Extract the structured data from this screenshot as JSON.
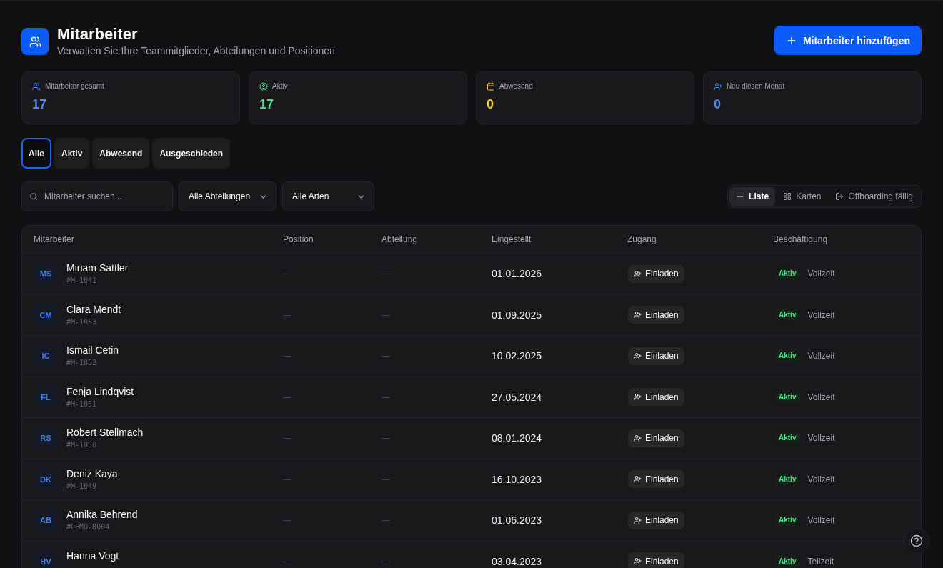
{
  "header": {
    "title": "Mitarbeiter",
    "subtitle": "Verwalten Sie Ihre Teammitglieder, Abteilungen und Positionen",
    "add_button": "Mitarbeiter hinzufügen"
  },
  "stats": [
    {
      "label": "Mitarbeiter gesamt",
      "value": "17",
      "color": "#4f86f7"
    },
    {
      "label": "Aktiv",
      "value": "17",
      "color": "#4ade80"
    },
    {
      "label": "Abwesend",
      "value": "0",
      "color": "#facc15"
    },
    {
      "label": "Neu diesen Monat",
      "value": "0",
      "color": "#4f86f7"
    }
  ],
  "tabs": [
    {
      "label": "Alle",
      "selected": true
    },
    {
      "label": "Aktiv",
      "selected": false
    },
    {
      "label": "Abwesend",
      "selected": false
    },
    {
      "label": "Ausgeschieden",
      "selected": false
    }
  ],
  "filters": {
    "search": {
      "placeholder": "Mitarbeiter suchen..."
    },
    "selects": [
      {
        "value": "Alle Abteilungen"
      },
      {
        "value": "Alle Arten"
      }
    ]
  },
  "view_modes": [
    {
      "label": "Liste",
      "selected": true
    },
    {
      "label": "Karten",
      "selected": false
    },
    {
      "label": "Offboarding fällig",
      "selected": false
    }
  ],
  "table": {
    "columns": [
      "Mitarbeiter",
      "Position",
      "Abteilung",
      "Eingestellt",
      "Zugang",
      "Beschäftigung"
    ],
    "rows": [
      {
        "initials": "MS",
        "name": "Miriam Sattler",
        "id": "#M-1041",
        "position": "—",
        "department": "—",
        "hired": "01.01.2026",
        "access": "Einladen",
        "status": "Aktiv",
        "employment": "Vollzeit"
      },
      {
        "initials": "CM",
        "name": "Clara Mendt",
        "id": "#M-1053",
        "position": "—",
        "department": "—",
        "hired": "01.09.2025",
        "access": "Einladen",
        "status": "Aktiv",
        "employment": "Vollzeit"
      },
      {
        "initials": "IC",
        "name": "Ismail Cetin",
        "id": "#M-1052",
        "position": "—",
        "department": "—",
        "hired": "10.02.2025",
        "access": "Einladen",
        "status": "Aktiv",
        "employment": "Vollzeit"
      },
      {
        "initials": "FL",
        "name": "Fenja Lindqvist",
        "id": "#M-1051",
        "position": "—",
        "department": "—",
        "hired": "27.05.2024",
        "access": "Einladen",
        "status": "Aktiv",
        "employment": "Vollzeit"
      },
      {
        "initials": "RS",
        "name": "Robert Stellmach",
        "id": "#M-1050",
        "position": "—",
        "department": "—",
        "hired": "08.01.2024",
        "access": "Einladen",
        "status": "Aktiv",
        "employment": "Vollzeit"
      },
      {
        "initials": "DK",
        "name": "Deniz Kaya",
        "id": "#M-1049",
        "position": "—",
        "department": "—",
        "hired": "16.10.2023",
        "access": "Einladen",
        "status": "Aktiv",
        "employment": "Vollzeit"
      },
      {
        "initials": "AB",
        "name": "Annika Behrend",
        "id": "#DEMO-B004",
        "position": "—",
        "department": "—",
        "hired": "01.06.2023",
        "access": "Einladen",
        "status": "Aktiv",
        "employment": "Vollzeit"
      },
      {
        "initials": "HV",
        "name": "Hanna Vogt",
        "position": "—",
        "department": "—",
        "hired": "03.04.2023",
        "access": "Einladen",
        "status": "Aktiv",
        "employment": "Teilzeit"
      }
    ]
  }
}
